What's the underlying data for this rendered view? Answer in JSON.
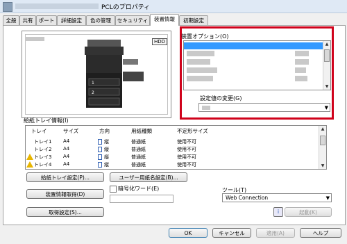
{
  "window": {
    "title": "PCLのプロパティ"
  },
  "tabs": [
    "全般",
    "共有",
    "ポート",
    "詳細設定",
    "色の管理",
    "セキュリティ",
    "装置情報",
    "初期設定"
  ],
  "device": {
    "storage_badge": "HDD"
  },
  "options": {
    "label": "装置オプション(O)"
  },
  "setting_change": {
    "label": "設定値の変更(G)"
  },
  "tray_info": {
    "label": "給紙トレイ情報(I)",
    "columns": [
      "トレイ",
      "サイズ",
      "方向",
      "用紙種類",
      "不定形サイズ"
    ],
    "rows": [
      {
        "tray": "トレイ1",
        "size": "A4",
        "direction": "縦",
        "paper": "普通紙",
        "custom": "使用不可",
        "warning": false
      },
      {
        "tray": "トレイ2",
        "size": "A4",
        "direction": "縦",
        "paper": "普通紙",
        "custom": "使用不可",
        "warning": false
      },
      {
        "tray": "トレイ3",
        "size": "A4",
        "direction": "縦",
        "paper": "普通紙",
        "custom": "使用不可",
        "warning": true
      },
      {
        "tray": "トレイ4",
        "size": "A4",
        "direction": "縦",
        "paper": "普通紙",
        "custom": "使用不可",
        "warning": true
      }
    ]
  },
  "buttons": {
    "tray_setting": "給紙トレイ設定(P)...",
    "paper_name": "ユーザー用紙名設定(B)...",
    "get_device_info": "装置情報取得(D)",
    "acquire_settings": "取得設定(S)...",
    "launch": "起動(K)",
    "ok": "OK",
    "cancel": "キャンセル",
    "apply": "適用(A)",
    "help": "ヘルプ"
  },
  "encryption": {
    "label": "暗号化ワード(E)",
    "value": ""
  },
  "tool": {
    "label": "ツール(T)",
    "selected": "Web Connection"
  },
  "colors": {
    "highlight_frame": "#d0021b",
    "selection": "#3399ff"
  }
}
